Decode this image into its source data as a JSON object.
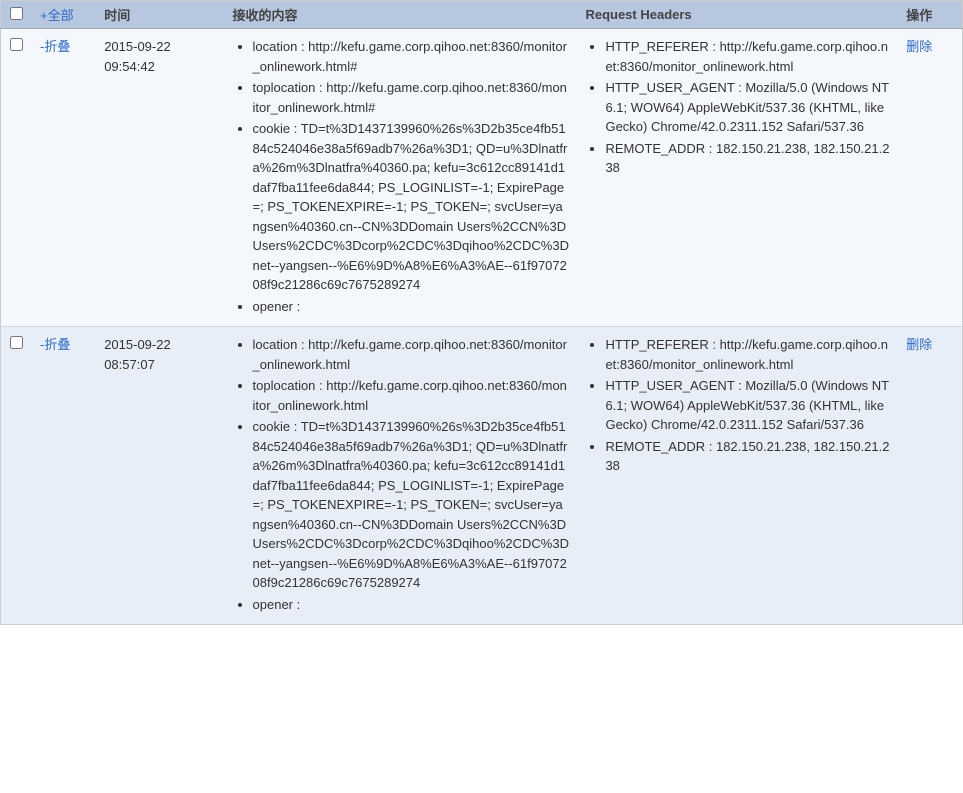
{
  "header": {
    "select_all": "+全部",
    "time": "时间",
    "content": "接收的内容",
    "request_headers": "Request Headers",
    "action": "操作"
  },
  "labels": {
    "fold": "-折叠",
    "delete": "删除"
  },
  "rows": [
    {
      "time": "2015-09-22 09:54:42",
      "content": [
        "location : http://kefu.game.corp.qihoo.net:8360/monitor_onlinework.html#",
        "toplocation : http://kefu.game.corp.qihoo.net:8360/monitor_onlinework.html#",
        "cookie : TD=t%3D1437139960%26s%3D2b35ce4fb5184c524046e38a5f69adb7%26a%3D1; QD=u%3Dlnatfra%26m%3Dlnatfra%40360.pa; kefu=3c612cc89141d1daf7fba11fee6da844; PS_LOGINLIST=-1; ExpirePage=; PS_TOKENEXPIRE=-1; PS_TOKEN=; svcUser=yangsen%40360.cn--CN%3DDomain Users%2CCN%3DUsers%2CDC%3Dcorp%2CDC%3Dqihoo%2CDC%3Dnet--yangsen--%E6%9D%A8%E6%A3%AE--61f9707208f9c21286c69c7675289274",
        "opener :"
      ],
      "headers": [
        "HTTP_REFERER : http://kefu.game.corp.qihoo.net:8360/monitor_onlinework.html",
        "HTTP_USER_AGENT : Mozilla/5.0 (Windows NT 6.1; WOW64) AppleWebKit/537.36 (KHTML, like Gecko) Chrome/42.0.2311.152 Safari/537.36",
        "REMOTE_ADDR : 182.150.21.238, 182.150.21.238"
      ]
    },
    {
      "time": "2015-09-22 08:57:07",
      "content": [
        "location : http://kefu.game.corp.qihoo.net:8360/monitor_onlinework.html",
        "toplocation : http://kefu.game.corp.qihoo.net:8360/monitor_onlinework.html",
        "cookie : TD=t%3D1437139960%26s%3D2b35ce4fb5184c524046e38a5f69adb7%26a%3D1; QD=u%3Dlnatfra%26m%3Dlnatfra%40360.pa; kefu=3c612cc89141d1daf7fba11fee6da844; PS_LOGINLIST=-1; ExpirePage=; PS_TOKENEXPIRE=-1; PS_TOKEN=; svcUser=yangsen%40360.cn--CN%3DDomain Users%2CCN%3DUsers%2CDC%3Dcorp%2CDC%3Dqihoo%2CDC%3Dnet--yangsen--%E6%9D%A8%E6%A3%AE--61f9707208f9c21286c69c7675289274",
        "opener :"
      ],
      "headers": [
        "HTTP_REFERER : http://kefu.game.corp.qihoo.net:8360/monitor_onlinework.html",
        "HTTP_USER_AGENT : Mozilla/5.0 (Windows NT 6.1; WOW64) AppleWebKit/537.36 (KHTML, like Gecko) Chrome/42.0.2311.152 Safari/537.36",
        "REMOTE_ADDR : 182.150.21.238, 182.150.21.238"
      ]
    }
  ]
}
